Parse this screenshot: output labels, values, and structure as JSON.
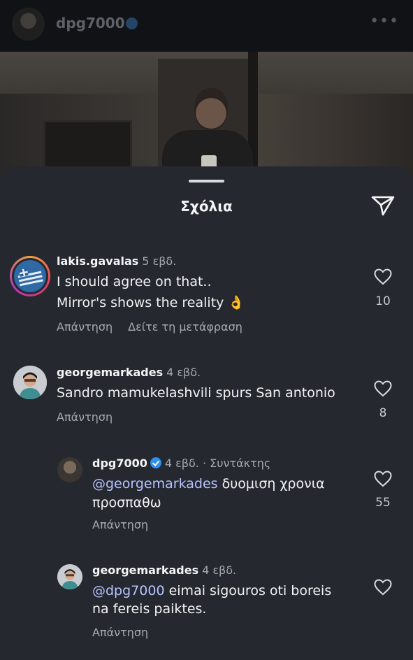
{
  "header": {
    "username": "dpg7000",
    "more": "•••"
  },
  "sheet": {
    "title": "Σχόλια"
  },
  "comments": [
    {
      "username": "lakis.gavalas",
      "time": "5 εβδ.",
      "line1": "I should agree on that..",
      "line2": "Mirror's shows the reality 👌",
      "reply_label": "Απάντηση",
      "translate_label": "Δείτε τη μετάφραση",
      "likes": "10"
    },
    {
      "username": "georgemarkades",
      "time": "4 εβδ.",
      "line1": "Sandro mamukelashvili spurs San antonio",
      "reply_label": "Απάντηση",
      "likes": "8"
    },
    {
      "username": "dpg7000",
      "time": "4 εβδ.",
      "author_label": "· Συντάκτης",
      "mention": "@georgemarkades",
      "line1_rest": " δυομιση χρονια",
      "line2": "προσπαθω",
      "reply_label": "Απάντηση",
      "likes": "55"
    },
    {
      "username": "georgemarkades",
      "time": "4 εβδ.",
      "mention": "@dpg7000",
      "line1_rest": " eimai sigouros oti boreis",
      "line2": "na fereis paiktes.",
      "reply_label": "Απάντηση"
    }
  ],
  "colors": {
    "sheet_bg": "#25292f",
    "mention": "#b7c3ff",
    "verified": "#2f8fec"
  }
}
